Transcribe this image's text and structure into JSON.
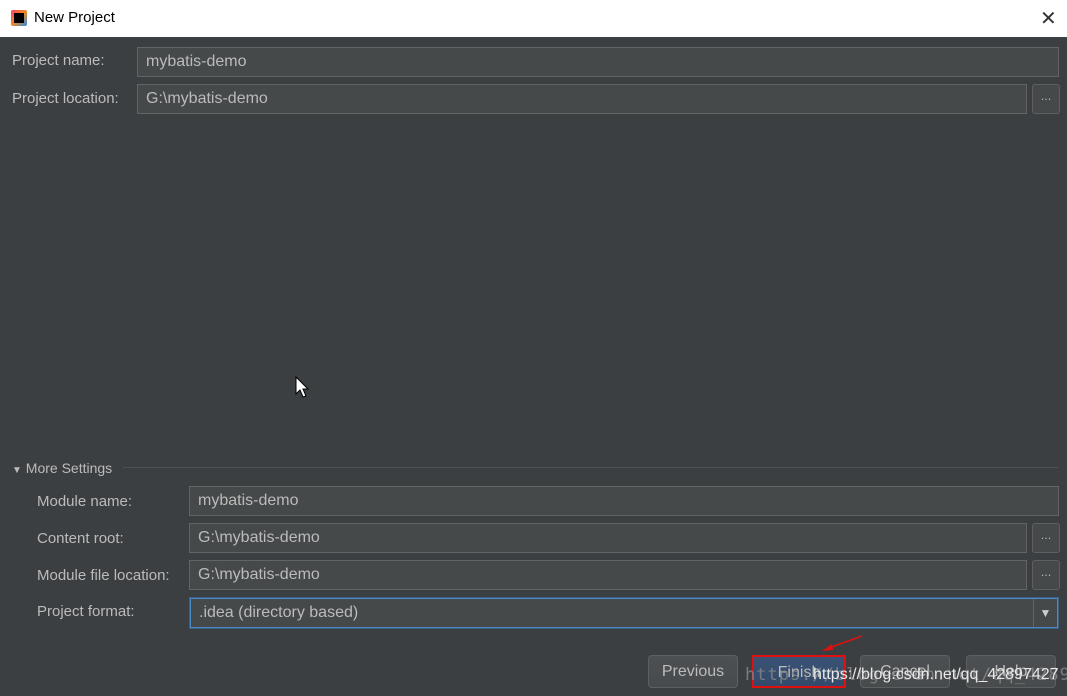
{
  "window": {
    "title": "New Project"
  },
  "form": {
    "project_name": {
      "label": "Project name:",
      "value": "mybatis-demo"
    },
    "project_location": {
      "label": "Project location:",
      "value": "G:\\mybatis-demo",
      "browse": "..."
    }
  },
  "more_settings": {
    "label": "More Settings",
    "module_name": {
      "label": "Module name:",
      "value": "mybatis-demo"
    },
    "content_root": {
      "label": "Content root:",
      "value": "G:\\mybatis-demo",
      "browse": "..."
    },
    "module_file_location": {
      "label": "Module file location:",
      "value": "G:\\mybatis-demo",
      "browse": "..."
    },
    "project_format": {
      "label": "Project format:",
      "value": ".idea (directory based)"
    }
  },
  "buttons": {
    "previous": "Previous",
    "finish": "Finish",
    "cancel": "Cancel",
    "help": "Help"
  },
  "watermark": {
    "faded": "https://blog.csdn.net/qq_42897427",
    "overlay": "https://blog.csdn.net/qq_42897427"
  },
  "colors": {
    "background": "#3c3f41",
    "field": "#45494a",
    "focus": "#4a88c7",
    "highlight_box": "#e01010"
  }
}
